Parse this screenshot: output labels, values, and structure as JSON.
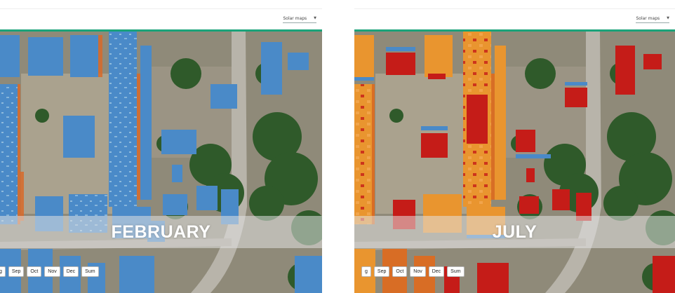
{
  "panels": [
    {
      "layer_select": "Solar maps",
      "month_label": "FEBRUARY",
      "months": [
        "g",
        "Sep",
        "Oct",
        "Nov",
        "Dec",
        "Sum"
      ]
    },
    {
      "layer_select": "Solar maps",
      "month_label": "JULY",
      "months": [
        "g",
        "Sep",
        "Oct",
        "Nov",
        "Dec",
        "Sum"
      ]
    }
  ],
  "colors": {
    "accent": "#1aa37a",
    "roof_low": "#4a8ac8",
    "roof_low_light": "#9ec6e2",
    "roof_high": "#c51c18",
    "roof_mid": "#e06a1c",
    "roof_warm": "#f2a64e",
    "vegetation": "#2f5a2a",
    "ground": "#a59c88",
    "road": "#b7b3a9"
  }
}
